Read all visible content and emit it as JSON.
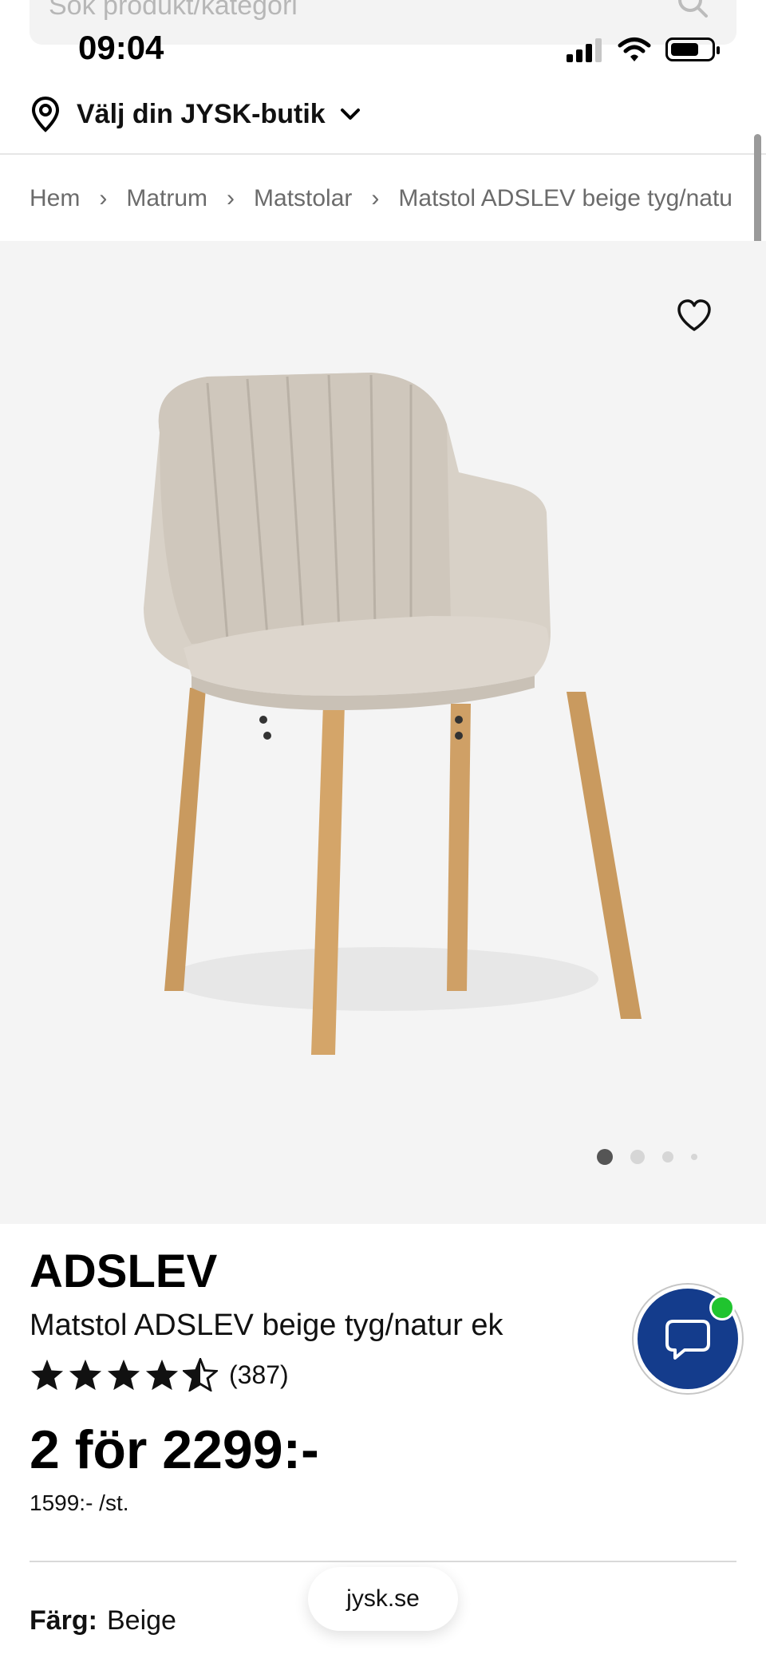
{
  "search": {
    "placeholder": "Sök produkt/kategori"
  },
  "status": {
    "time": "09:04"
  },
  "store": {
    "label": "Välj din JYSK-butik"
  },
  "breadcrumb": [
    "Hem",
    "Matrum",
    "Matstolar",
    "Matstol ADSLEV beige tyg/natu"
  ],
  "product": {
    "brand": "ADSLEV",
    "name": "Matstol ADSLEV beige tyg/natur ek",
    "rating_value": 4.5,
    "review_count": "(387)",
    "price": "2 för 2299:-",
    "unit_price": "1599:- /st.",
    "color_label": "Färg:",
    "color_value": "Beige"
  },
  "gallery": {
    "current": 1,
    "total": 4
  },
  "url": "jysk.se",
  "colors": {
    "brand_blue": "#143c8c",
    "online_green": "#20c42f"
  }
}
